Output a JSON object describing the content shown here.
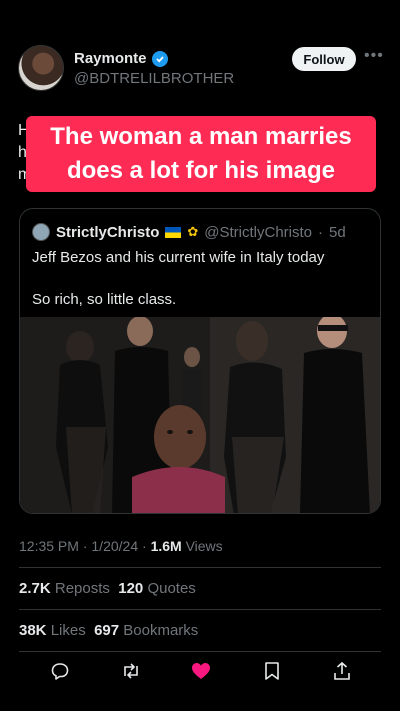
{
  "author": {
    "name": "Raymonte",
    "handle": "@BDTRELILBROTHER",
    "follow_label": "Follow"
  },
  "tweet_text_fragments": [
    "H",
    "h",
    "mo"
  ],
  "caption_lines": [
    "The woman a man marries",
    "does a lot for his image"
  ],
  "quoted_tweet": {
    "name": "StrictlyChristo",
    "handle": "@StrictlyChristo",
    "separator": "·",
    "age": "5d",
    "line1": "Jeff Bezos and his current wife in Italy today",
    "line2": "So rich, so little class."
  },
  "meta": {
    "time": "12:35 PM",
    "date": "1/20/24",
    "separator": "·",
    "views_count": "1.6M",
    "views_label": "Views"
  },
  "stats": {
    "reposts_count": "2.7K",
    "reposts_label": "Reposts",
    "quotes_count": "120",
    "quotes_label": "Quotes",
    "likes_count": "38K",
    "likes_label": "Likes",
    "bookmarks_count": "697",
    "bookmarks_label": "Bookmarks"
  },
  "icons": [
    "reply-icon",
    "repost-icon",
    "like-icon",
    "bookmark-icon",
    "share-icon"
  ],
  "colors": {
    "accent": "#1d9bf0",
    "caption_bg": "#fe2c55",
    "like": "#f91880",
    "muted": "#71767b"
  }
}
